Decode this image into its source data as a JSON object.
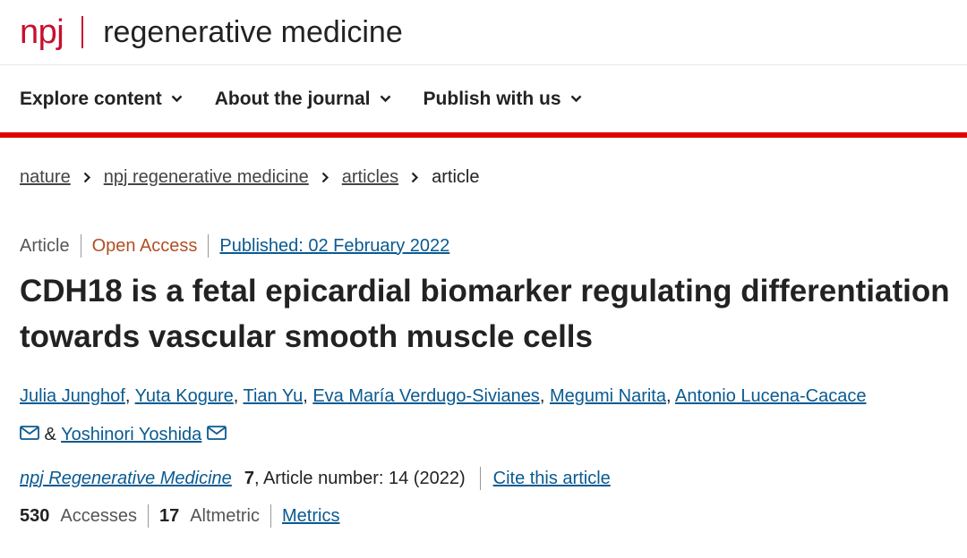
{
  "header": {
    "logo_short": "npj",
    "logo_name": "regenerative medicine"
  },
  "nav": {
    "items": [
      {
        "label": "Explore content"
      },
      {
        "label": "About the journal"
      },
      {
        "label": "Publish with us"
      }
    ]
  },
  "breadcrumb": {
    "items": [
      "nature",
      "npj regenerative medicine",
      "articles"
    ],
    "current": "article"
  },
  "article": {
    "type": "Article",
    "access": "Open Access",
    "published": "Published: 02 February 2022",
    "title": "CDH18 is a fetal epicardial biomarker regulating differentiation towards vascular smooth muscle cells",
    "authors": [
      "Julia Junghof",
      "Yuta Kogure",
      "Tian Yu",
      "Eva María Verdugo-Sivianes",
      "Megumi Narita",
      "Antonio Lucena-Cacace",
      "Yoshinori Yoshida"
    ],
    "author_separator": ", ",
    "and_sign": " & ",
    "journal": "npj Regenerative Medicine",
    "volume": "7",
    "article_number": ", Article number: 14 (2022)",
    "cite_label": "Cite this article"
  },
  "metrics": {
    "accesses_count": "530",
    "accesses_label": "Accesses",
    "altmetric_count": "17",
    "altmetric_label": "Altmetric",
    "metrics_link": "Metrics"
  },
  "colors": {
    "brand_red": "#c8102e",
    "link_blue": "#0a5a91",
    "open_access": "#b24f23"
  }
}
